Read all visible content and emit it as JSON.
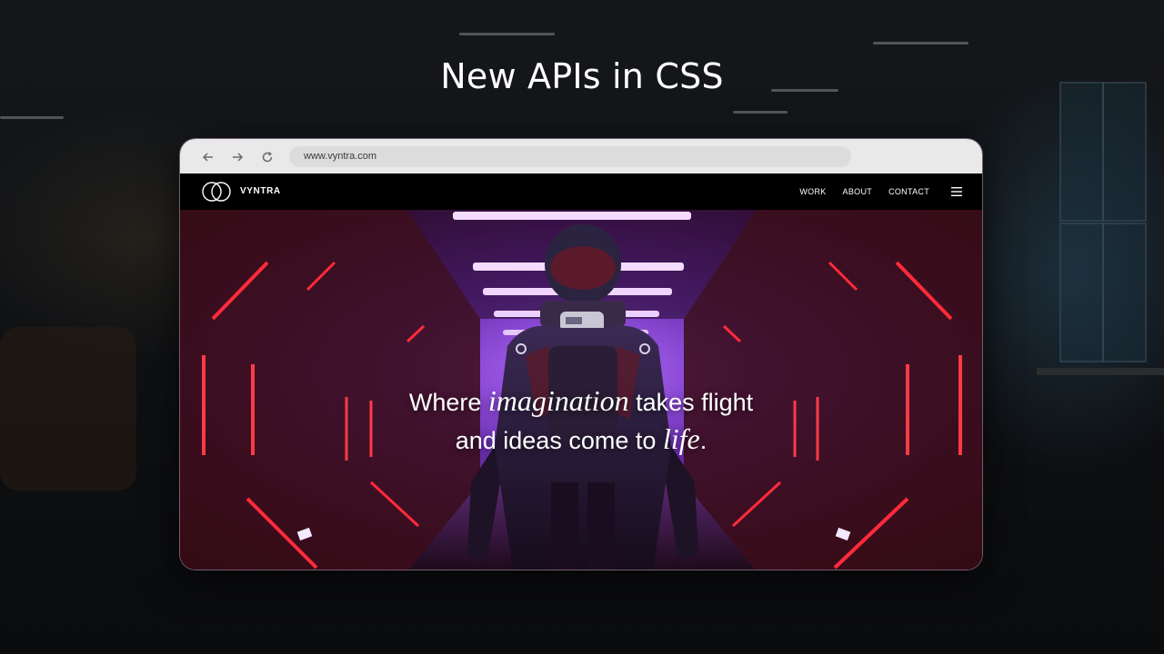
{
  "slide": {
    "title": "New APIs in CSS"
  },
  "browser": {
    "url": "www.vyntra.com",
    "nav_icons": [
      "back-arrow-icon",
      "forward-arrow-icon",
      "reload-icon"
    ]
  },
  "site": {
    "brand": "VYNTRA",
    "menu": [
      "WORK",
      "ABOUT",
      "CONTACT"
    ],
    "hero": {
      "line1_before": "Where ",
      "line1_em": "imagination",
      "line1_after": " takes flight",
      "line2_before": "and ideas come to ",
      "line2_em": "life",
      "line2_after": "."
    }
  },
  "colors": {
    "hero_purple": "#6a2fb0",
    "neon_red": "#ff2a3a",
    "chrome_bar": "#e9e9ea"
  }
}
